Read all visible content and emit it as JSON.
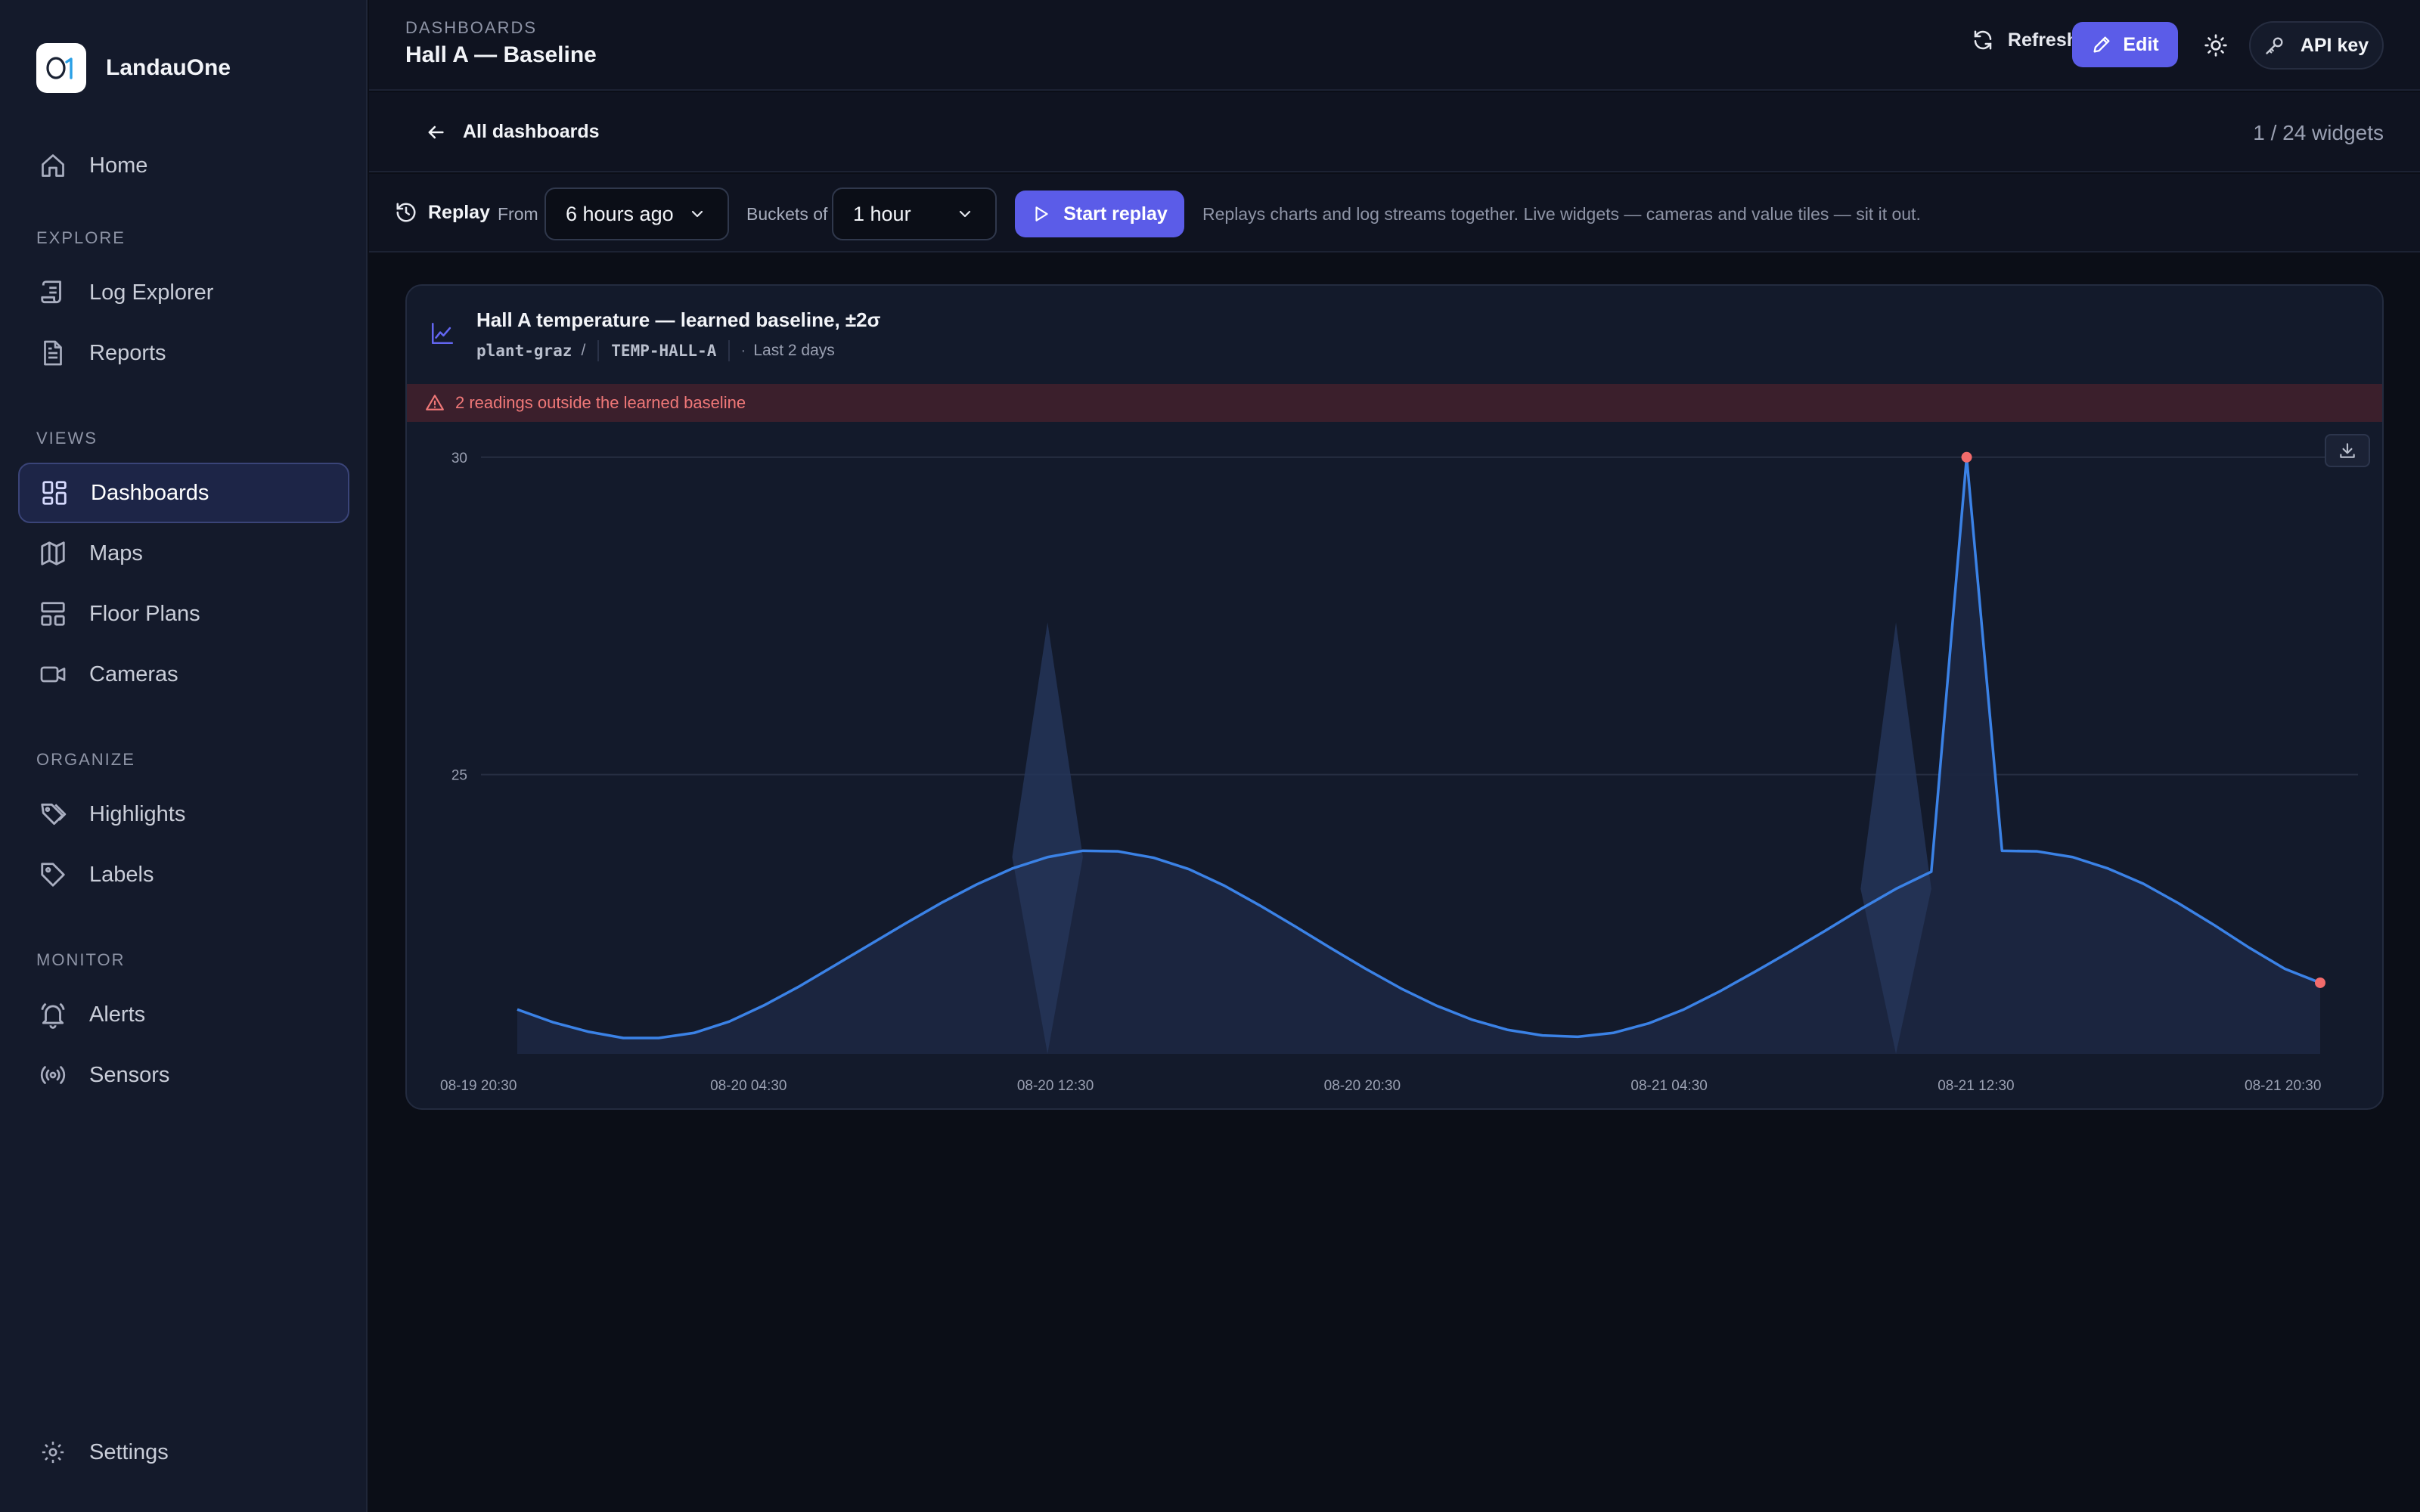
{
  "app": {
    "brand_name": "LandauOne",
    "brand_logo_text": "O1",
    "accent": "#5b5ce8"
  },
  "sidebar": {
    "home": {
      "label": "Home",
      "icon": "home-icon"
    },
    "sections": {
      "explore": "EXPLORE",
      "views": "VIEWS",
      "organize": "ORGANIZE",
      "monitor": "MONITOR"
    },
    "explore_items": [
      {
        "label": "Log Explorer",
        "icon": "scroll-icon"
      },
      {
        "label": "Reports",
        "icon": "report-icon"
      }
    ],
    "views_items": [
      {
        "label": "Dashboards",
        "icon": "dashboard-icon",
        "active": true
      },
      {
        "label": "Maps",
        "icon": "map-icon"
      },
      {
        "label": "Floor Plans",
        "icon": "floor-plan-icon"
      },
      {
        "label": "Cameras",
        "icon": "camera-icon"
      }
    ],
    "organize_items": [
      {
        "label": "Highlights",
        "icon": "tags-icon"
      },
      {
        "label": "Labels",
        "icon": "tag-icon"
      }
    ],
    "monitor_items": [
      {
        "label": "Alerts",
        "icon": "bell-icon"
      },
      {
        "label": "Sensors",
        "icon": "sensor-icon"
      }
    ],
    "settings": {
      "label": "Settings",
      "icon": "gear-icon"
    }
  },
  "header": {
    "breadcrumb": "DASHBOARDS",
    "title": "Hall A — Baseline",
    "refresh_label": "Refresh",
    "edit_label": "Edit",
    "api_key_label": "API key"
  },
  "subnav": {
    "back_label": "All dashboards",
    "widget_count": "1 / 24 widgets"
  },
  "replay": {
    "label": "Replay",
    "from_label": "From",
    "from_value": "6 hours ago",
    "buckets_label": "Buckets of",
    "buckets_value": "1 hour",
    "start_label": "Start replay",
    "hint": "Replays charts and log streams together. Live widgets — cameras and value tiles — sit it out."
  },
  "widget": {
    "title": "Hall A temperature — learned baseline, ±2σ",
    "source": "plant-graz",
    "source_sep": "/",
    "tag": "TEMP-HALL-A",
    "range_sep": "·",
    "range": "Last 2 days",
    "alert": "2 readings outside the learned baseline"
  },
  "chart_data": {
    "type": "line",
    "title": "Hall A temperature — learned baseline, ±2σ",
    "y_ticks": [
      25,
      30
    ],
    "ylim": [
      20.6,
      30.2
    ],
    "x_ticks": [
      "08-19 20:30",
      "08-20 04:30",
      "08-20 12:30",
      "08-20 20:30",
      "08-21 04:30",
      "08-21 12:30",
      "08-21 20:30"
    ],
    "x_hours_start": 1,
    "x_hours_end": 48,
    "grid": true,
    "series_color": "#3b82e6",
    "anomaly_color": "#f26b6b",
    "band_color": "#243558",
    "values": [
      21.3,
      21.1,
      20.95,
      20.85,
      20.85,
      20.93,
      21.11,
      21.37,
      21.67,
      22.0,
      22.33,
      22.66,
      22.98,
      23.27,
      23.52,
      23.7,
      23.8,
      23.79,
      23.69,
      23.51,
      23.25,
      22.94,
      22.61,
      22.27,
      21.94,
      21.63,
      21.36,
      21.14,
      20.98,
      20.89,
      20.87,
      20.93,
      21.08,
      21.3,
      21.58,
      21.89,
      22.21,
      22.54,
      22.88,
      23.2,
      23.47,
      30.0,
      23.8,
      23.79,
      23.7,
      23.52,
      23.28,
      22.97,
      22.63,
      22.27,
      21.94,
      21.72
    ],
    "anomalies": [
      {
        "index": 41,
        "value": 30.0
      },
      {
        "index": 51,
        "value": 21.72
      }
    ],
    "band_spikes": [
      {
        "index": 15,
        "upper": 27.4,
        "lower": 20.6
      },
      {
        "index": 39,
        "upper": 27.4,
        "lower": 20.6
      }
    ]
  }
}
